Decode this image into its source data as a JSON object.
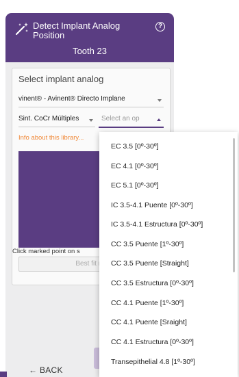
{
  "header": {
    "title": "Detect Implant Analog Position",
    "subtitle": "Tooth 23",
    "wand_icon": "magic-wand-icon",
    "help_icon": "help-icon"
  },
  "card": {
    "title": "Select implant analog",
    "library_select_value": "vinent® - Avinent® Directo Implane",
    "material_select_value": "Sint. CoCr Múltiples",
    "analog_select_placeholder": "Select an op",
    "info_link": "Info about this library...",
    "click_hint": "Click marked point on s",
    "best_fit_label": "Best fit ma"
  },
  "footer": {
    "back_label": "BACK",
    "back_icon": "arrow-left-icon"
  },
  "dropdown": {
    "options": [
      "EC 3.5 [0º-30º]",
      "EC 4.1 [0º-30º]",
      "EC 5.1 [0º-30º]",
      "IC 3.5-4.1 Puente [0º-30º]",
      "IC 3.5-4.1 Estructura [0º-30º]",
      "CC 3.5 Puente [1º-30º]",
      "CC 3.5 Puente [Straight]",
      "CC 3.5 Estructura [0º-30º]",
      "CC 4.1 Puente [1º-30º]",
      "CC 4.1 Puente [Sraight]",
      "CC 4.1 Estructura [0º-30º]",
      "Transepithelial 4.8 [1º-30º]"
    ]
  },
  "colors": {
    "brand_purple": "#5a3d82",
    "info_orange": "#f08a3a",
    "panel_bg": "#ededee"
  }
}
